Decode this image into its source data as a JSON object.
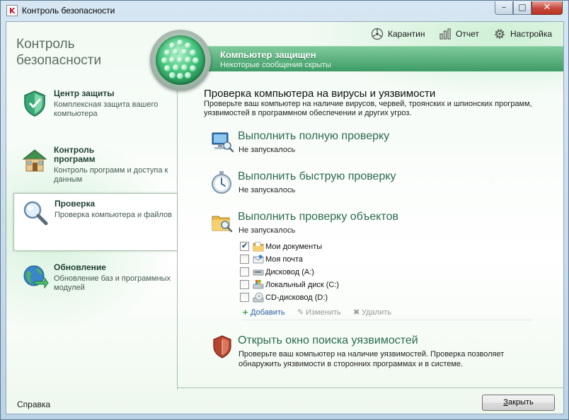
{
  "window": {
    "title": "Контроль безопасности",
    "app_icon_letter": "K",
    "controls": {
      "minimize": "–",
      "maximize": "□",
      "close": "✕"
    }
  },
  "sidebar": {
    "title_line1": "Контроль",
    "title_line2": "безопасности",
    "items": [
      {
        "title": "Центр защиты",
        "desc": "Комплексная защита вашего компьютера",
        "icon": "shield-icon"
      },
      {
        "title_line1": "Контроль",
        "title_line2": "программ",
        "desc": "Контроль программ и доступа к данным",
        "icon": "house-icon"
      },
      {
        "title": "Проверка",
        "desc": "Проверка компьютера и файлов",
        "icon": "magnifier-icon",
        "selected": true
      },
      {
        "title": "Обновление",
        "desc": "Обновление баз и программных модулей",
        "icon": "globe-update-icon"
      }
    ]
  },
  "toolbar": {
    "quarantine": "Карантин",
    "report": "Отчет",
    "settings": "Настройка"
  },
  "status": {
    "title": "Компьютер защищен",
    "subtitle": "Некоторые сообщения скрыты",
    "color": "#3d9c66"
  },
  "main": {
    "heading": "Проверка компьютера на вирусы и уязвимости",
    "description": "Проверьте ваш компьютер на наличие вирусов, червей, троянских и шпионских программ, уязвимостей в программном обеспечении и других угроз.",
    "tasks": [
      {
        "title": "Выполнить полную проверку",
        "status": "Не запускалось",
        "icon": "computer-scan-icon"
      },
      {
        "title": "Выполнить быструю проверку",
        "status": "Не запускалось",
        "icon": "stopwatch-icon"
      },
      {
        "title": "Выполнить проверку объектов",
        "status": "Не запускалось",
        "icon": "folder-scan-icon"
      }
    ],
    "objects": [
      {
        "label": "Мои документы",
        "checked": true,
        "icon": "documents-folder-icon"
      },
      {
        "label": "Моя почта",
        "checked": false,
        "icon": "mail-icon"
      },
      {
        "label": "Дисковод (A:)",
        "checked": false,
        "icon": "floppy-drive-icon"
      },
      {
        "label": "Локальный диск (C:)",
        "checked": false,
        "icon": "hard-disk-icon"
      },
      {
        "label": "CD-дисковод (D:)",
        "checked": false,
        "icon": "cd-drive-icon"
      }
    ],
    "actions": {
      "add": "Добавить",
      "edit": "Изменить",
      "delete": "Удалить"
    },
    "vulnerability": {
      "title": "Открыть окно поиска уязвимостей",
      "description": "Проверьте ваш компьютер на наличие уязвимостей. Проверка позволяет обнаружить уязвимости в сторонних программах и в системе.",
      "icon": "shield-vulnerability-icon"
    }
  },
  "footer": {
    "help": "Справка",
    "close_prefix": "З",
    "close_rest": "акрыть"
  }
}
